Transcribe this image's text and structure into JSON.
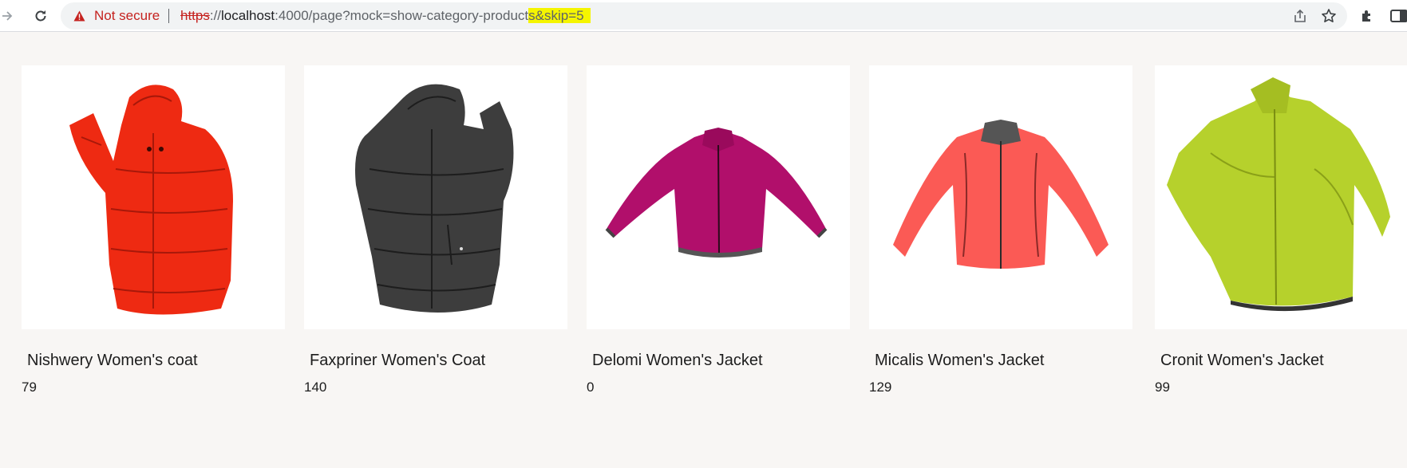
{
  "browser": {
    "security_label": "Not secure",
    "url": {
      "scheme": "https",
      "sep": "://",
      "host": "localhost",
      "rest": ":4000/page?mock=show-category-product",
      "highlighted": "s&skip=5"
    },
    "icons": [
      "forward-icon",
      "reload-icon",
      "warning-icon",
      "share-icon",
      "star-icon",
      "extensions-icon",
      "side-panel-icon"
    ]
  },
  "products": [
    {
      "name": "Nishwery Women's coat",
      "price": "79",
      "color": "#ee2a12"
    },
    {
      "name": "Faxpriner Women's Coat",
      "price": "140",
      "color": "#3d3d3d"
    },
    {
      "name": "Delomi Women's Jacket",
      "price": "0",
      "color": "#b10f6b"
    },
    {
      "name": "Micalis Women's Jacket",
      "price": "129",
      "color": "#fb5a55"
    },
    {
      "name": "Cronit Women's Jacket",
      "price": "99",
      "color": "#b6d12c"
    }
  ]
}
